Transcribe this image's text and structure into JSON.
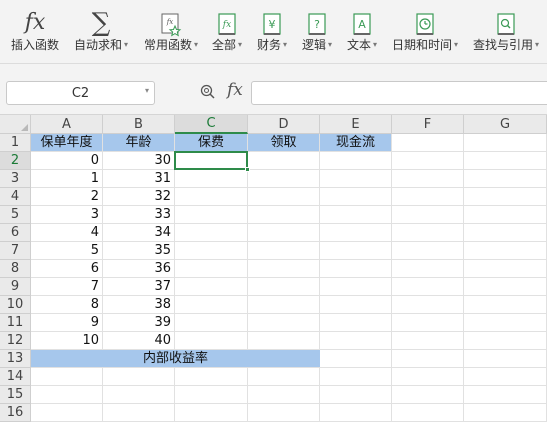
{
  "toolbar": {
    "buttons": [
      {
        "label": "插入函数",
        "icon": "fx-icon",
        "caret": false
      },
      {
        "label": "自动求和",
        "icon": "sigma-icon",
        "caret": true
      },
      {
        "label": "常用函数",
        "icon": "star-function-icon",
        "caret": true
      },
      {
        "label": "全部",
        "icon": "function-book-icon",
        "caret": true
      },
      {
        "label": "财务",
        "icon": "yen-book-icon",
        "caret": true
      },
      {
        "label": "逻辑",
        "icon": "question-book-icon",
        "caret": true
      },
      {
        "label": "文本",
        "icon": "text-book-icon",
        "caret": true
      },
      {
        "label": "日期和时间",
        "icon": "clock-book-icon",
        "caret": true
      },
      {
        "label": "查找与引用",
        "icon": "search-book-icon",
        "caret": true
      }
    ],
    "fx_glyph": "fx",
    "sigma_glyph": "∑",
    "caret_glyph": "▾"
  },
  "formula_bar": {
    "name_box": "C2",
    "fx_label": "fx",
    "value": ""
  },
  "sheet": {
    "columns": [
      "A",
      "B",
      "C",
      "D",
      "E",
      "F",
      "G"
    ],
    "selected_column": "C",
    "rows": [
      "1",
      "2",
      "3",
      "4",
      "5",
      "6",
      "7",
      "8",
      "9",
      "10",
      "11",
      "12",
      "13",
      "14",
      "15",
      "16"
    ],
    "selected_row": "2",
    "header_row": [
      "保单年度",
      "年龄",
      "保费",
      "领取",
      "现金流"
    ],
    "data": [
      {
        "A": "0",
        "B": "30"
      },
      {
        "A": "1",
        "B": "31"
      },
      {
        "A": "2",
        "B": "32"
      },
      {
        "A": "3",
        "B": "33"
      },
      {
        "A": "4",
        "B": "34"
      },
      {
        "A": "5",
        "B": "35"
      },
      {
        "A": "6",
        "B": "36"
      },
      {
        "A": "7",
        "B": "37"
      },
      {
        "A": "8",
        "B": "38"
      },
      {
        "A": "9",
        "B": "39"
      },
      {
        "A": "10",
        "B": "40"
      }
    ],
    "row13_label": "内部收益率",
    "active_cell": "C2",
    "header_fill": "#a6c7ec",
    "selection_color": "#2e8b4a"
  }
}
